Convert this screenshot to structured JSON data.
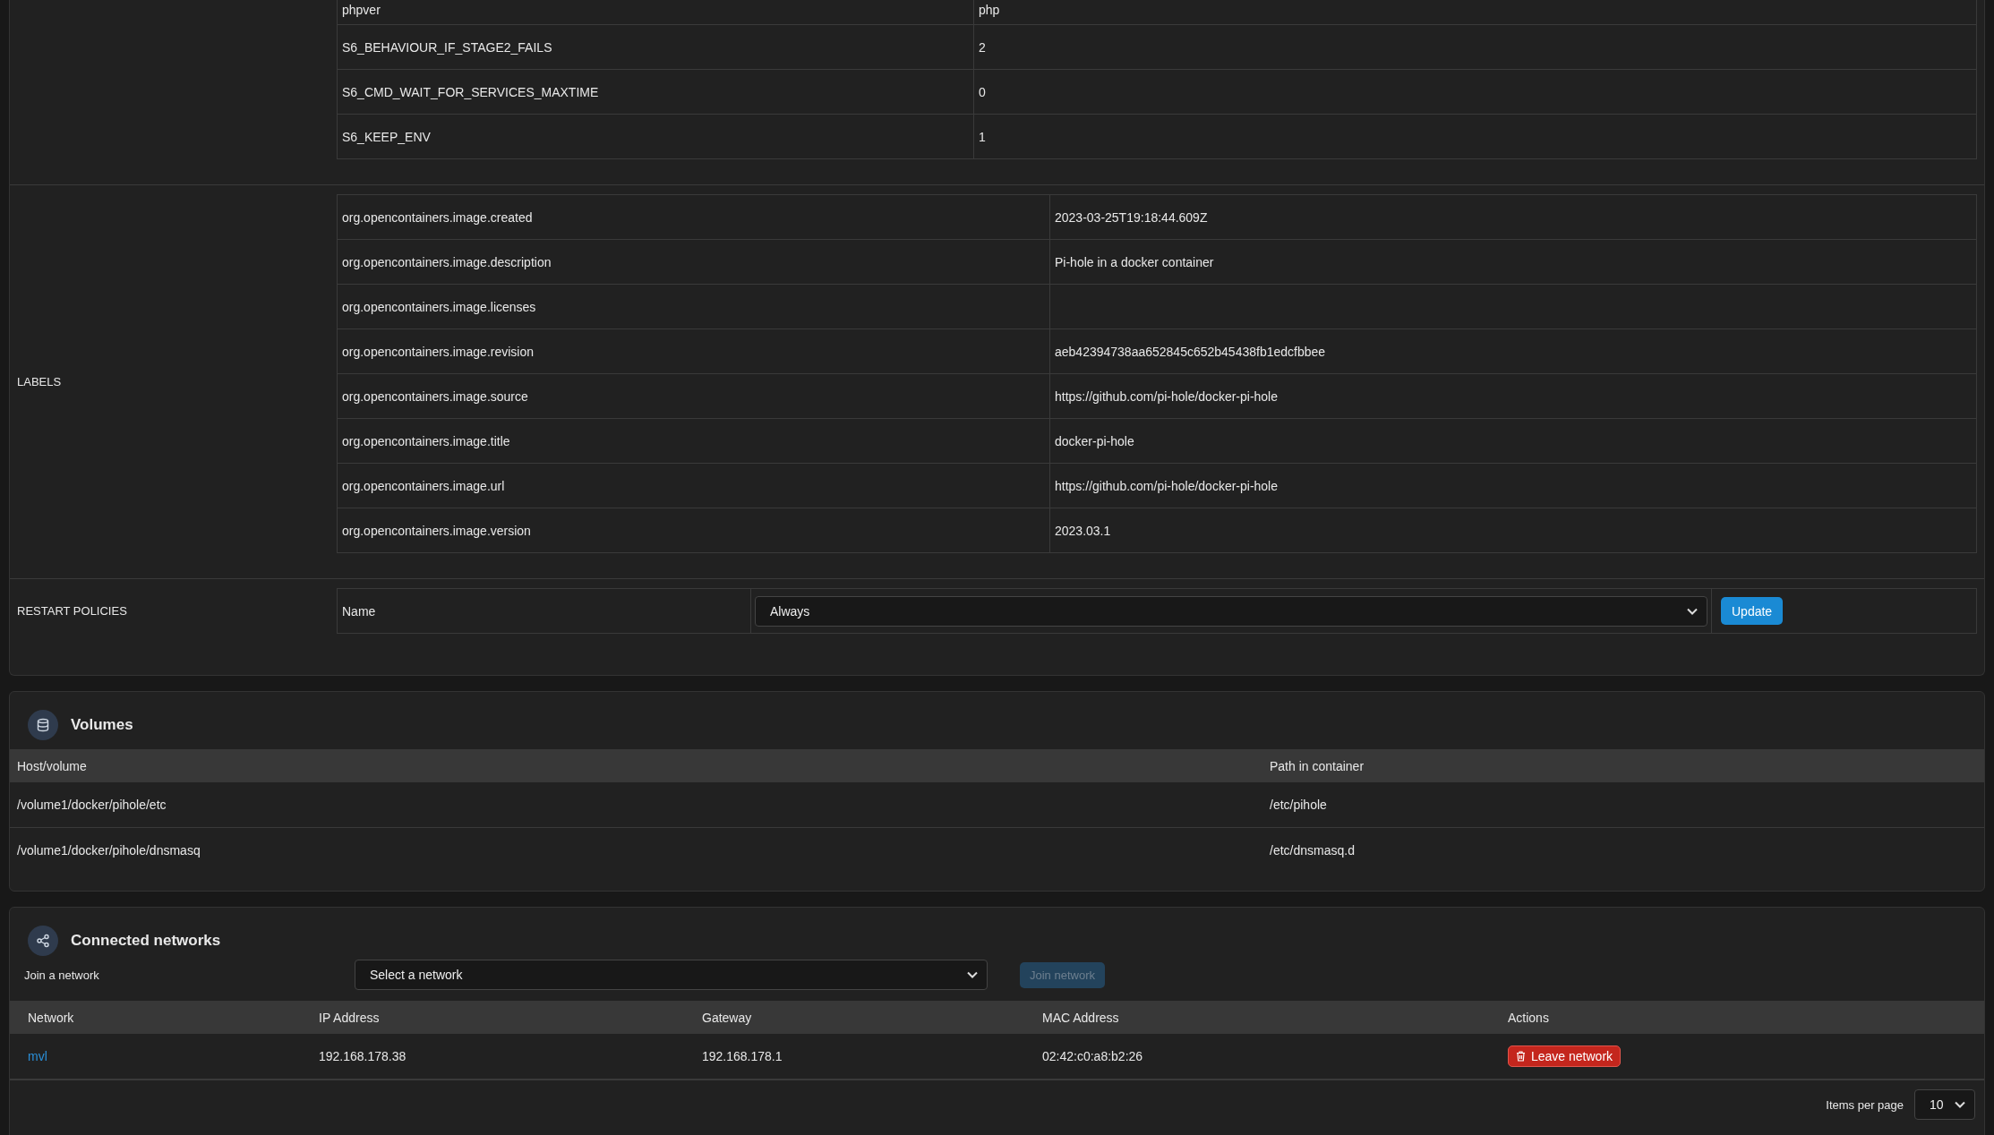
{
  "environment": {
    "rows": [
      {
        "name": "phpver",
        "value": "php"
      },
      {
        "name": "S6_BEHAVIOUR_IF_STAGE2_FAILS",
        "value": "2"
      },
      {
        "name": "S6_CMD_WAIT_FOR_SERVICES_MAXTIME",
        "value": "0"
      },
      {
        "name": "S6_KEEP_ENV",
        "value": "1"
      }
    ]
  },
  "labels": {
    "title": "LABELS",
    "rows": [
      {
        "name": "org.opencontainers.image.created",
        "value": "2023-03-25T19:18:44.609Z"
      },
      {
        "name": "org.opencontainers.image.description",
        "value": "Pi-hole in a docker container"
      },
      {
        "name": "org.opencontainers.image.licenses"
      },
      {
        "name": "org.opencontainers.image.revision",
        "value": "aeb42394738aa652845c652b45438fb1edcfbbee"
      },
      {
        "name": "org.opencontainers.image.source",
        "value": "https://github.com/pi-hole/docker-pi-hole"
      },
      {
        "name": "org.opencontainers.image.title",
        "value": "docker-pi-hole"
      },
      {
        "name": "org.opencontainers.image.url",
        "value": "https://github.com/pi-hole/docker-pi-hole"
      },
      {
        "name": "org.opencontainers.image.version",
        "value": "2023.03.1"
      }
    ]
  },
  "restart_policies": {
    "title": "RESTART POLICIES",
    "name_label": "Name",
    "select": {
      "value": "Always"
    },
    "button": "Update"
  },
  "volumes": {
    "title": "Volumes",
    "columns": [
      "Host/volume",
      "Path in container"
    ],
    "rows": [
      [
        "/volume1/docker/pihole/etc",
        "/etc/pihole"
      ],
      [
        "/volume1/docker/pihole/dnsmasq",
        "/etc/dnsmasq.d"
      ]
    ]
  },
  "networks": {
    "title": "Connected networks",
    "join_label": "Join a network",
    "select": {
      "placeholder": "Select a network"
    },
    "join_button": {
      "label": "Join network",
      "disabled": true
    },
    "columns": [
      "Network",
      "IP Address",
      "Gateway",
      "MAC Address",
      "Actions"
    ],
    "rows": [
      {
        "network": "mvl",
        "ip": "192.168.178.38",
        "gateway": "192.168.178.1",
        "mac": "02:42:c0:a8:b2:26",
        "action": "Leave network"
      }
    ],
    "items_per_page_label": "Items per page",
    "items_per_page": "10"
  }
}
